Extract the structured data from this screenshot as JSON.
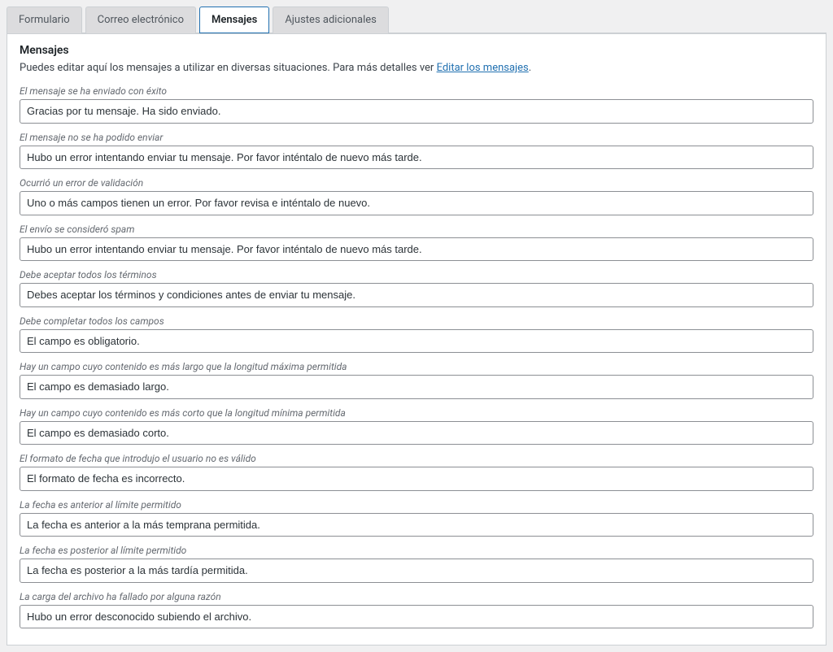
{
  "tabs": {
    "formulario": "Formulario",
    "correo": "Correo electrónico",
    "mensajes": "Mensajes",
    "ajustes": "Ajustes adicionales"
  },
  "panel": {
    "title": "Mensajes",
    "intro_text_a": "Puedes editar aquí los mensajes a utilizar en diversas situaciones. Para más detalles ver ",
    "intro_link": "Editar los mensajes",
    "intro_text_b": "."
  },
  "fields": [
    {
      "label": "El mensaje se ha enviado con éxito",
      "value": "Gracias por tu mensaje. Ha sido enviado."
    },
    {
      "label": "El mensaje no se ha podido enviar",
      "value": "Hubo un error intentando enviar tu mensaje. Por favor inténtalo de nuevo más tarde."
    },
    {
      "label": "Ocurrió un error de validación",
      "value": "Uno o más campos tienen un error. Por favor revisa e inténtalo de nuevo."
    },
    {
      "label": "El envío se consideró spam",
      "value": "Hubo un error intentando enviar tu mensaje. Por favor inténtalo de nuevo más tarde."
    },
    {
      "label": "Debe aceptar todos los términos",
      "value": "Debes aceptar los términos y condiciones antes de enviar tu mensaje."
    },
    {
      "label": "Debe completar todos los campos",
      "value": "El campo es obligatorio."
    },
    {
      "label": "Hay un campo cuyo contenido es más largo que la longitud máxima permitida",
      "value": "El campo es demasiado largo."
    },
    {
      "label": "Hay un campo cuyo contenido es más corto que la longitud mínima permitida",
      "value": "El campo es demasiado corto."
    },
    {
      "label": "El formato de fecha que introdujo el usuario no es válido",
      "value": "El formato de fecha es incorrecto."
    },
    {
      "label": "La fecha es anterior al límite permitido",
      "value": "La fecha es anterior a la más temprana permitida."
    },
    {
      "label": "La fecha es posterior al límite permitido",
      "value": "La fecha es posterior a la más tardía permitida."
    },
    {
      "label": "La carga del archivo ha fallado por alguna razón",
      "value": "Hubo un error desconocido subiendo el archivo."
    }
  ]
}
